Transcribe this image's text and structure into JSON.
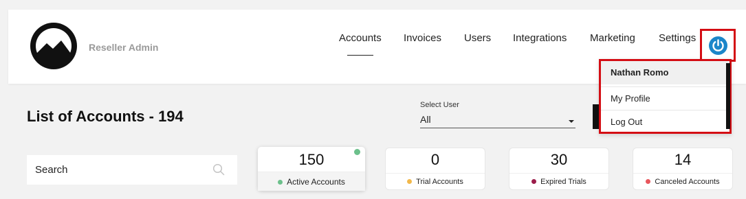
{
  "header": {
    "brand": "Reseller Admin",
    "nav": [
      "Accounts",
      "Invoices",
      "Users",
      "Integrations",
      "Marketing",
      "Settings"
    ],
    "active_nav": "Accounts",
    "power_icon": "power-icon"
  },
  "user_menu": {
    "name": "Nathan Romo",
    "items": [
      "My Profile",
      "Log Out"
    ]
  },
  "main": {
    "title": "List of Accounts - 194",
    "select_user": {
      "label": "Select User",
      "value": "All"
    },
    "search": {
      "placeholder": "Search"
    },
    "cards": [
      {
        "value": "150",
        "label": "Active Accounts",
        "dot": "#6cc08b",
        "active": true
      },
      {
        "value": "0",
        "label": "Trial Accounts",
        "dot": "#f2b84b"
      },
      {
        "value": "30",
        "label": "Expired Trials",
        "dot": "#9b1d4a"
      },
      {
        "value": "14",
        "label": "Canceled Accounts",
        "dot": "#e8565c"
      }
    ]
  },
  "colors": {
    "accent": "#1b86c9",
    "highlight": "#d40d14"
  }
}
